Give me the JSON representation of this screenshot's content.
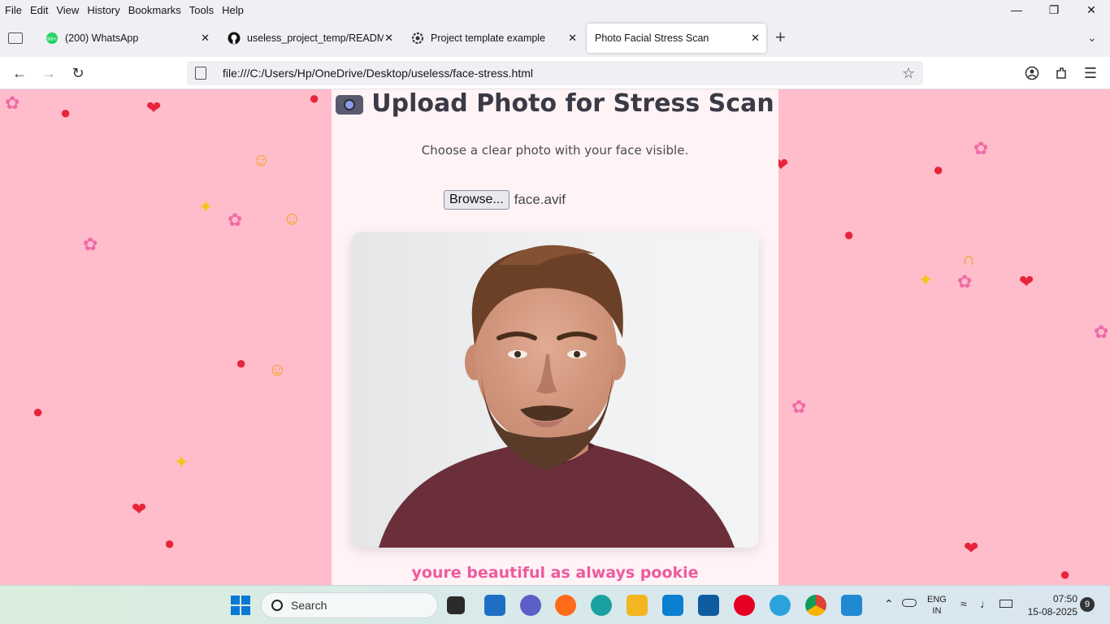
{
  "menubar": {
    "items": [
      "File",
      "Edit",
      "View",
      "History",
      "Bookmarks",
      "Tools",
      "Help"
    ],
    "accel": [
      "F",
      "E",
      "V",
      "S",
      "B",
      "T",
      "H"
    ]
  },
  "tabs": [
    {
      "title": "(200) WhatsApp",
      "badge": "99+",
      "icon": "whatsapp-icon"
    },
    {
      "title": "useless_project_temp/README.md",
      "icon": "github-icon"
    },
    {
      "title": "Project template example",
      "icon": "settings-icon"
    },
    {
      "title": "Photo Facial Stress Scan",
      "icon": "none"
    }
  ],
  "url": "file:///C:/Users/Hp/OneDrive/Desktop/useless/face-stress.html",
  "page": {
    "title": "Upload Photo for Stress Scan",
    "subtitle": "Choose a clear photo with your face visible.",
    "browse_label": "Browse...",
    "file_name": "face.avif",
    "tagline": "youre beautiful as always pookie"
  },
  "colors": {
    "background": "#ffbcca",
    "card": "#fff3f5",
    "tagline": "#ee5a9e"
  },
  "taskbar": {
    "search_label": "Search",
    "language": "ENG",
    "region": "IN",
    "time": "07:50",
    "date": "15-08-2025",
    "notifications": "9"
  }
}
